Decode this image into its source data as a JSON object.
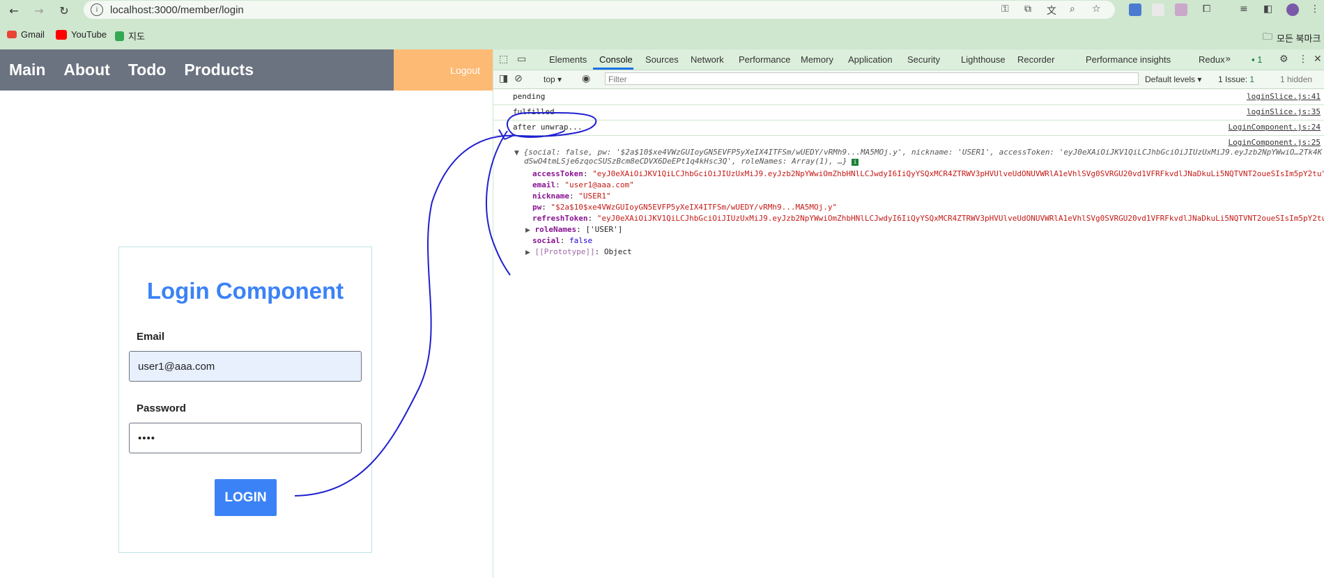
{
  "browser": {
    "url": "localhost:3000/member/login",
    "bookmarks": [
      "Gmail",
      "YouTube",
      "지도"
    ],
    "bookmarks_folder": "모든 북마크"
  },
  "app": {
    "nav_links": [
      "Main",
      "About",
      "Todo",
      "Products"
    ],
    "logout_label": "Logout",
    "login": {
      "title": "Login Component",
      "email_label": "Email",
      "email_value": "user1@aaa.com",
      "password_label": "Password",
      "password_value": "••••",
      "button_label": "LOGIN"
    }
  },
  "devtools": {
    "tabs": [
      "Elements",
      "Console",
      "Sources",
      "Network",
      "Performance",
      "Memory",
      "Application",
      "Security",
      "Lighthouse",
      "Recorder",
      "Performance insights",
      "Redux"
    ],
    "active_tab": "Console",
    "issues_badge": "1",
    "context": "top",
    "filter_placeholder": "Filter",
    "levels": "Default levels",
    "issues_text": "1 Issue:",
    "issues_count": "1",
    "hidden_text": "1 hidden",
    "logs": [
      {
        "message": "pending",
        "source": "loginSlice.js:41"
      },
      {
        "message": "fulfilled",
        "source": "loginSlice.js:35"
      },
      {
        "message": "after unwrap...",
        "source": "LoginComponent.js:24"
      },
      {
        "message": "",
        "source": "LoginComponent.js:25"
      }
    ],
    "object_summary_1": "{social: false, pw: '$2a$10$xe4VWzGUIoyGN5EVFP5yXeIX4ITFSm/wUEDY/vRMh9...MA5MOj.y', nickname: 'USER1', accessToken: 'eyJ0eXAiOiJKV1QiLCJhbGciOiJIUzUxMiJ9.eyJzb2NpYWwiO…2Tk4K",
    "object_summary_2": "dSwO4tmLSje6zqocSUSzBcm8eCDVX6DeEPt1q4kHsc3Q', roleNames: Array(1), …}",
    "props": [
      {
        "key": "accessToken",
        "value": "\"eyJ0eXAiOiJKV1QiLCJhbGciOiJIUzUxMiJ9.eyJzb2NpYWwiOmZhbHNlLCJwdyI6IiQyYSQxMCR4ZTRWV3pHVUlveUdONUVWRlA1eVhlSVg0SVRGU20vd1VFRFkvdlJNaDkuLi5NQTVNT2oueSIsIm5pY2tu\""
      },
      {
        "key": "email",
        "value": "\"user1@aaa.com\""
      },
      {
        "key": "nickname",
        "value": "\"USER1\""
      },
      {
        "key": "pw",
        "value": "\"$2a$10$xe4VWzGUIoyGN5EVFP5yXeIX4ITFSm/wUEDY/vRMh9...MA5MOj.y\""
      },
      {
        "key": "refreshToken",
        "value": "\"eyJ0eXAiOiJKV1QiLCJhbGciOiJIUzUxMiJ9.eyJzb2NpYWwiOmZhbHNlLCJwdyI6IiQyYSQxMCR4ZTRWV3pHVUlveUdONUVWRlA1eVhlSVg0SVRGU20vd1VFRFkvdlJNaDkuLi5NQTVNT2oueSIsIm5pY2tu\""
      },
      {
        "key": "roleNames",
        "value": "['USER']"
      },
      {
        "key": "social",
        "value": "false"
      },
      {
        "key": "[[Prototype]]",
        "value": "Object"
      }
    ]
  }
}
